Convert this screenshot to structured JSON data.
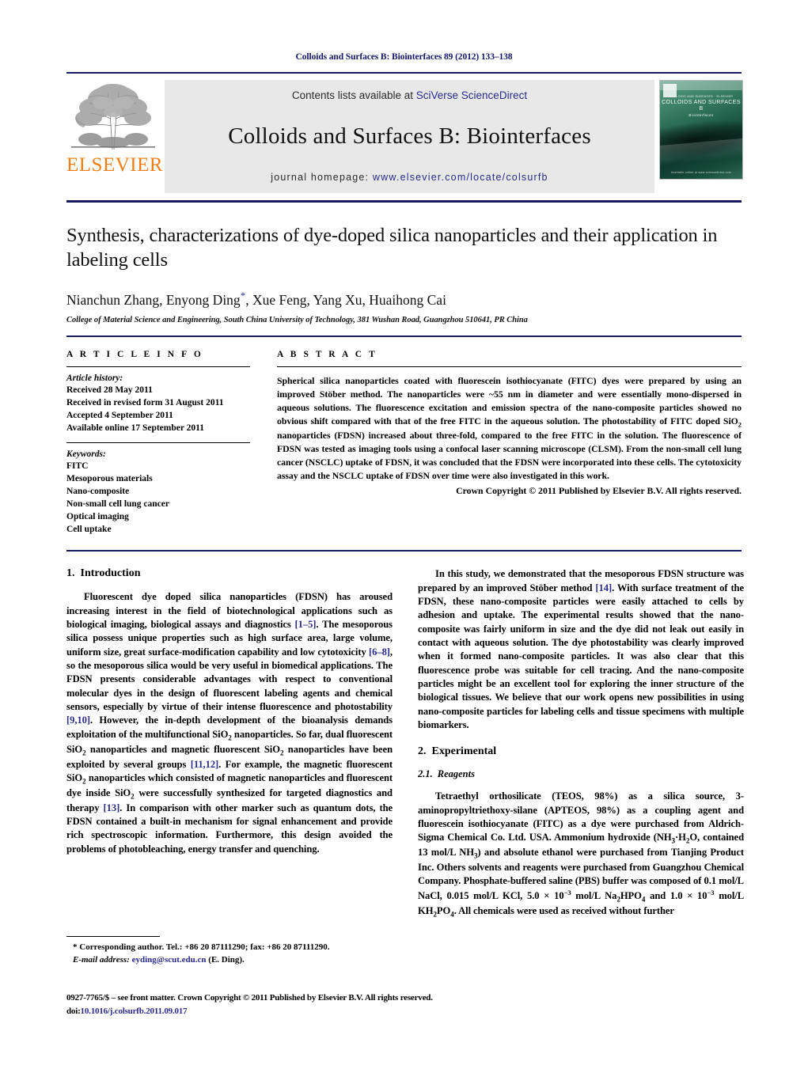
{
  "running_head": "Colloids and Surfaces B: Biointerfaces 89 (2012) 133–138",
  "masthead": {
    "publisher_wordmark": "ELSEVIER",
    "contents_prefix": "Contents lists available at ",
    "contents_link": "SciVerse ScienceDirect",
    "journal_title": "Colloids and Surfaces B: Biointerfaces",
    "homepage_prefix": "journal homepage: ",
    "homepage_url": "www.elsevier.com/locate/colsurfb",
    "cover": {
      "line_top": "COLLOIDS AND SURFACES  ·  ELSEVIER",
      "line_main": "COLLOIDS AND SURFACES B",
      "line_sub": "Biointerfaces",
      "line_bottom": "Available online at www.sciencedirect.com"
    }
  },
  "article": {
    "title": "Synthesis, characterizations of dye-doped silica nanoparticles and their application in labeling cells",
    "authors": "Nianchun Zhang, Enyong Ding",
    "corresponding_mark": "*",
    "authors_rest": ", Xue Feng, Yang Xu, Huaihong Cai",
    "affiliation": "College of Material Science and Engineering, South China University of Technology, 381 Wushan Road, Guangzhou 510641, PR China"
  },
  "article_info": {
    "heading": "A R T I C L E   I N F O",
    "history_label": "Article history:",
    "history": [
      "Received 28 May 2011",
      "Received in revised form 31 August 2011",
      "Accepted 4 September 2011",
      "Available online 17 September 2011"
    ],
    "keywords_label": "Keywords:",
    "keywords": [
      "FITC",
      "Mesoporous materials",
      "Nano-composite",
      "Non-small cell lung cancer",
      "Optical imaging",
      "Cell uptake"
    ]
  },
  "abstract": {
    "heading": "A B S T R A C T",
    "body_parts": [
      "Spherical silica nanoparticles coated with fluorescein isothiocyanate (FITC) dyes were prepared by using an improved Stöber method. The nanoparticles were ~55 nm in diameter and were essentially mono-dispersed in aqueous solutions. The fluorescence excitation and emission spectra of the nano-composite particles showed no obvious shift compared with that of the free FITC in the aqueous solution. The photostability of FITC doped SiO",
      "2",
      " nanoparticles (FDSN) increased about three-fold, compared to the free FITC in the solution. The fluorescence of FDSN was tested as imaging tools using a confocal laser scanning microscope (CLSM). From the non-small cell lung cancer (NSCLC) uptake of FDSN, it was concluded that the FDSN were incorporated into these cells. The cytotoxicity assay and the NSCLC uptake of FDSN over time were also investigated in this work."
    ],
    "copyright": "Crown Copyright © 2011 Published by Elsevier B.V. All rights reserved."
  },
  "sections": {
    "introduction": {
      "number": "1.",
      "title": "Introduction",
      "p1_a": "Fluorescent dye doped silica nanoparticles (FDSN) has aroused increasing interest in the field of biotechnological applications such as biological imaging, biological assays and diagnostics ",
      "p1_r1": "[1–5]",
      "p1_b": ". The mesoporous silica possess unique properties such as high surface area, large volume, uniform size, great surface-modification capability and low cytotoxicity ",
      "p1_r2": "[6–8]",
      "p1_c": ", so the mesoporous silica would be very useful in biomedical applications. The FDSN presents considerable advantages with respect to conventional molecular dyes in the design of fluorescent labeling agents and chemical sensors, especially by virtue of their intense fluorescence and photostability ",
      "p1_r3": "[9,10]",
      "p1_d": ". However, the in-depth development of the bioanalysis demands exploitation of the multifunctional SiO",
      "p1_e": " nanoparticles. So far, dual fluorescent SiO",
      "p1_f": " nanoparticles and magnetic fluorescent SiO",
      "p1_g": " nanoparticles have been exploited by several groups ",
      "p1_r4": "[11,12]",
      "p1_h": ". For example, the magnetic fluorescent SiO",
      "p1_i": " nanoparticles which consisted of magnetic nanoparticles and fluorescent dye inside SiO",
      "p1_j": " were successfully synthesized for targeted diagnostics and therapy ",
      "p1_r5": "[13]",
      "p1_k": ". In comparison with other marker such as quantum dots, the FDSN contained a built-in mechanism for signal enhancement and provide rich spectroscopic information. Furthermore, this design avoided the problems of photobleaching, energy transfer and quenching."
    },
    "study_para": {
      "a": "In this study, we demonstrated that the mesoporous FDSN structure was prepared by an improved Stöber method ",
      "ref": "[14]",
      "b": ". With surface treatment of the FDSN, these nano-composite particles were easily attached to cells by adhesion and uptake. The experimental results showed that the nano-composite was fairly uniform in size and the dye did not leak out easily in contact with aqueous solution. The dye photostability was clearly improved when it formed nano-composite particles. It was also clear that this fluorescence probe was suitable for cell tracing. And the nano-composite particles might be an excellent tool for exploring the inner structure of the biological tissues. We believe that our work opens new possibilities in using nano-composite particles for labeling cells and tissue specimens with multiple biomarkers."
    },
    "experimental": {
      "number": "2.",
      "title": "Experimental"
    },
    "reagents": {
      "number": "2.1.",
      "title": "Reagents",
      "a": "Tetraethyl orthosilicate (TEOS, 98%) as a silica source, 3-aminopropyltriethoxy-silane (APTEOS, 98%) as a coupling agent and fluorescein isothiocyanate (FITC) as a dye were purchased from Aldrich-Sigma Chemical Co. Ltd. USA. Ammonium hydroxide (NH",
      "b": "·H",
      "c": "O, contained 13 mol/L NH",
      "d": ") and absolute ethanol were purchased from Tianjing Product Inc. Others solvents and reagents were purchased from Guangzhou Chemical Company. Phosphate-buffered saline (PBS) buffer was composed of 0.1 mol/L NaCl, 0.015 mol/L KCl, 5.0 × 10",
      "e": " mol/L Na",
      "f": "HPO",
      "g": " and 1.0 × 10",
      "h": " mol/L KH",
      "i": "PO",
      "j": ". All chemicals were used as received without further"
    }
  },
  "footnote": {
    "corresponding": "* Corresponding author. Tel.: +86 20 87111290; fax: +86 20 87111290.",
    "email_label": "E-mail address:",
    "email": "eyding@scut.edu.cn",
    "email_suffix": "(E. Ding)."
  },
  "frontmatter": {
    "line1": "0927-7765/$ – see front matter. Crown Copyright © 2011 Published by Elsevier B.V. All rights reserved.",
    "doi_label": "doi:",
    "doi_value": "10.1016/j.colsurfb.2011.09.017"
  },
  "colors": {
    "navy_rule": "#1a1a5e",
    "link_blue": "#2b2b8c",
    "elsevier_orange": "#f07e12",
    "banner_gray": "#e8e8e8"
  }
}
